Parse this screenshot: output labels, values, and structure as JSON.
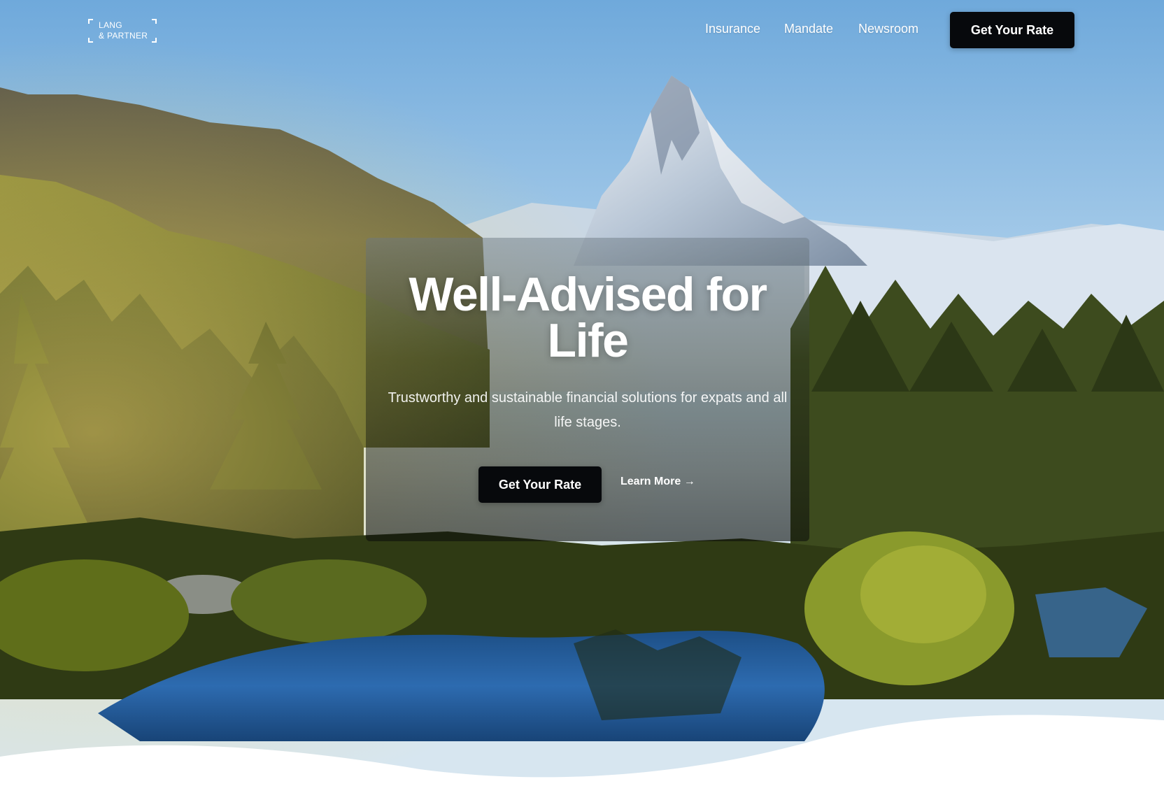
{
  "brand": {
    "line1": "LANG",
    "line2": "& PARTNER"
  },
  "nav": {
    "links": [
      "Insurance",
      "Mandate",
      "Newsroom"
    ],
    "cta_label": "Get Your Rate"
  },
  "hero": {
    "title": "Well-Advised for Life",
    "subtitle": "Trustworthy and sustainable financial solutions for expats and all life stages.",
    "primary_cta": "Get Your Rate",
    "secondary_cta": "Learn More →",
    "background_image": "alpine-mountain-lake-landscape"
  },
  "colors": {
    "button_bg": "#07090c",
    "text": "#ffffff",
    "sky": "#7fb3df"
  }
}
